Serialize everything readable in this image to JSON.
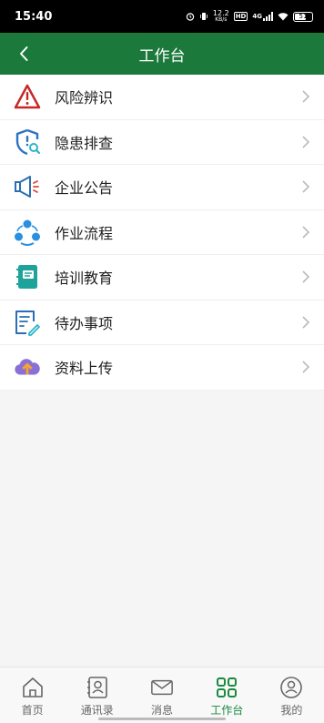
{
  "status": {
    "time": "15:40",
    "speed_top": "12.2",
    "speed_unit": "KB/s",
    "hd": "HD",
    "network": "4G",
    "battery": "51"
  },
  "header": {
    "title": "工作台"
  },
  "menu": {
    "items": [
      {
        "label": "风险辨识",
        "icon": "warning-triangle-icon"
      },
      {
        "label": "隐患排查",
        "icon": "shield-search-icon"
      },
      {
        "label": "企业公告",
        "icon": "speaker-icon"
      },
      {
        "label": "作业流程",
        "icon": "workflow-icon"
      },
      {
        "label": "培训教育",
        "icon": "notebook-icon"
      },
      {
        "label": "待办事项",
        "icon": "todo-list-icon"
      },
      {
        "label": "资料上传",
        "icon": "cloud-upload-icon"
      }
    ]
  },
  "tabbar": {
    "items": [
      {
        "label": "首页",
        "icon": "home-icon"
      },
      {
        "label": "通讯录",
        "icon": "contacts-icon"
      },
      {
        "label": "消息",
        "icon": "mail-icon"
      },
      {
        "label": "工作台",
        "icon": "grid-icon",
        "active": true
      },
      {
        "label": "我的",
        "icon": "profile-icon"
      }
    ]
  },
  "colors": {
    "header_bg": "#1b7a3b",
    "active_tab": "#1b8a3f"
  }
}
